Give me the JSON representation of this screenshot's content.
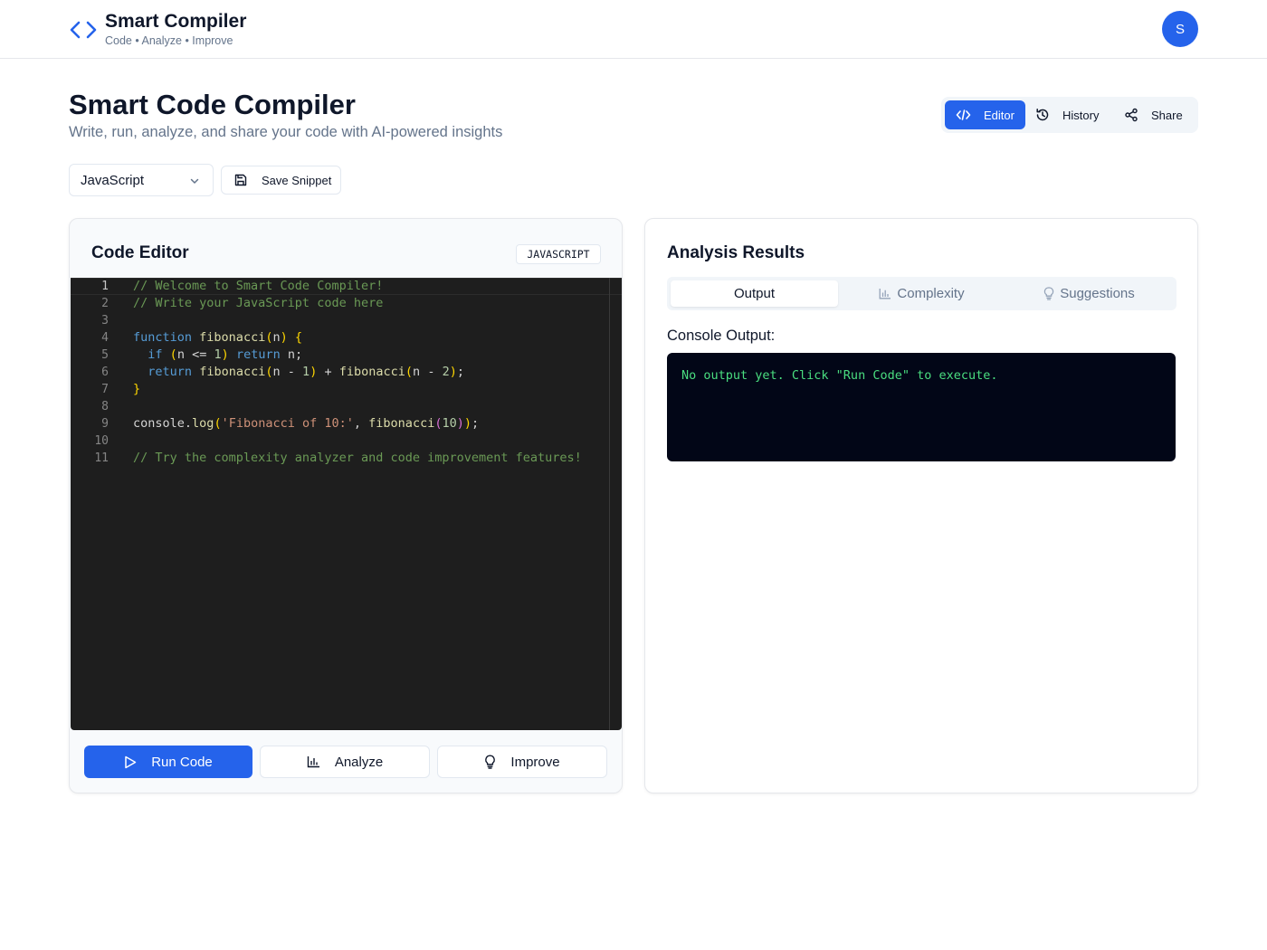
{
  "colors": {
    "accent": "#2563eb",
    "console_bg": "#020617",
    "console_text": "#4ade80",
    "editor_bg": "#1e1e1e"
  },
  "header": {
    "brand_icon": "code-brackets-icon",
    "title": "Smart Compiler",
    "subtitle": "Code • Analyze • Improve",
    "avatar_initial": "S"
  },
  "page": {
    "title": "Smart Code Compiler",
    "subtitle": "Write, run, analyze, and share your code with AI-powered insights"
  },
  "view_tabs": [
    {
      "label": "Editor",
      "icon": "code-icon",
      "active": true
    },
    {
      "label": "History",
      "icon": "history-icon",
      "active": false
    },
    {
      "label": "Share",
      "icon": "share-icon",
      "active": false
    }
  ],
  "controls": {
    "language": "JavaScript",
    "save_label": "Save Snippet"
  },
  "editor": {
    "title": "Code Editor",
    "language_badge": "JAVASCRIPT",
    "line_numbers": [
      "1",
      "2",
      "3",
      "4",
      "5",
      "6",
      "7",
      "8",
      "9",
      "10",
      "11"
    ],
    "active_line": 1,
    "lines": [
      "// Welcome to Smart Code Compiler!",
      "// Write your JavaScript code here",
      "",
      "function fibonacci(n) {",
      "  if (n <= 1) return n;",
      "  return fibonacci(n - 1) + fibonacci(n - 2);",
      "}",
      "",
      "console.log('Fibonacci of 10:', fibonacci(10));",
      "",
      "// Try the complexity analyzer and code improvement features!"
    ],
    "actions": {
      "run": "Run Code",
      "analyze": "Analyze",
      "improve": "Improve"
    }
  },
  "results": {
    "title": "Analysis Results",
    "tabs": [
      {
        "label": "Output",
        "active": true
      },
      {
        "label": "Complexity",
        "icon": "bar-chart-icon",
        "active": false
      },
      {
        "label": "Suggestions",
        "icon": "lightbulb-icon",
        "active": false
      }
    ],
    "console_label": "Console Output:",
    "console_text": "No output yet. Click \"Run Code\" to execute."
  }
}
